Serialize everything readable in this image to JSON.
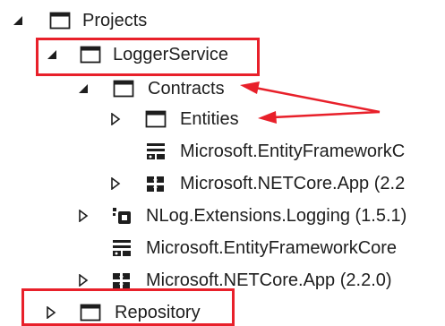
{
  "tree": {
    "nodes": [
      {
        "label": "Projects",
        "icon": "folder-window-icon",
        "state": "expanded"
      },
      {
        "label": "LoggerService",
        "icon": "folder-window-icon",
        "state": "expanded"
      },
      {
        "label": "Contracts",
        "icon": "folder-window-icon",
        "state": "expanded"
      },
      {
        "label": "Entities",
        "icon": "folder-window-icon",
        "state": "collapsed"
      },
      {
        "label": "Microsoft.EntityFrameworkC",
        "icon": "nuget-package-icon",
        "state": "leaf"
      },
      {
        "label": "Microsoft.NETCore.App (2.2",
        "icon": "sdk-framework-icon",
        "state": "collapsed"
      },
      {
        "label": "NLog.Extensions.Logging (1.5.1)",
        "icon": "nuget-reference-icon",
        "state": "collapsed"
      },
      {
        "label": "Microsoft.EntityFrameworkCore",
        "icon": "nuget-package-icon",
        "state": "leaf"
      },
      {
        "label": "Microsoft.NETCore.App (2.2.0)",
        "icon": "sdk-framework-icon",
        "state": "collapsed"
      },
      {
        "label": "Repository",
        "icon": "folder-window-icon",
        "state": "collapsed"
      }
    ]
  },
  "annotations": {
    "highlight_color": "#e8202a",
    "highlighted": [
      "LoggerService",
      "Repository"
    ],
    "arrow_targets": [
      "Contracts",
      "Entities"
    ]
  }
}
